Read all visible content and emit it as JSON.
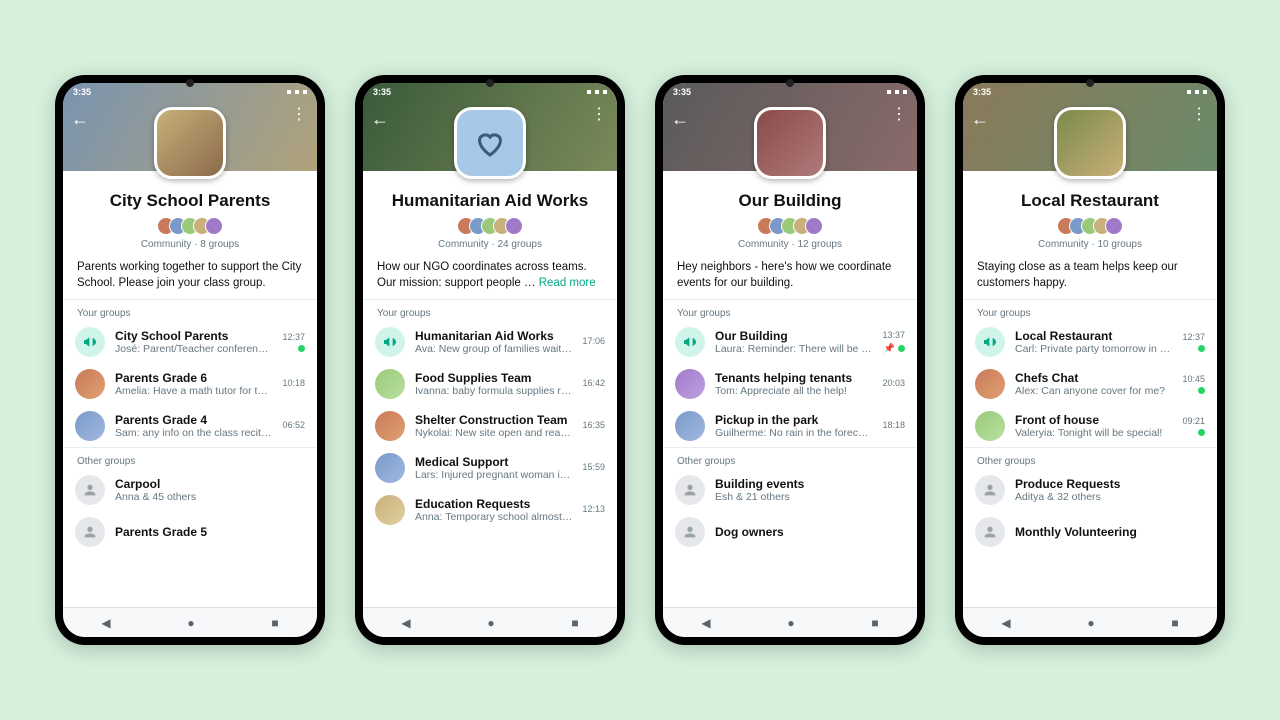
{
  "status_time": "3:35",
  "phones": [
    {
      "title": "City School Parents",
      "meta": "Community · 8 groups",
      "desc": "Parents working together to support the City School. Please join your class group.",
      "read_more": false,
      "your_label": "Your groups",
      "other_label": "Other groups",
      "your_groups": [
        {
          "name": "City School Parents",
          "sender": "José",
          "msg": "Parent/Teacher conferences …",
          "time": "12:37",
          "unread": true,
          "announce": true
        },
        {
          "name": "Parents Grade 6",
          "sender": "Amelia",
          "msg": "Have a math tutor for the upco…",
          "time": "10:18",
          "av": "ra0"
        },
        {
          "name": "Parents Grade 4",
          "sender": "Sam",
          "msg": "any info on the class recital?",
          "time": "06:52",
          "av": "ra1"
        }
      ],
      "other_groups": [
        {
          "name": "Carpool",
          "sub": "Anna & 45 others",
          "grey": true
        },
        {
          "name": "Parents Grade 5",
          "sub": "",
          "grey": true
        }
      ]
    },
    {
      "title": "Humanitarian Aid Works",
      "meta": "Community · 24 groups",
      "desc": "How our NGO coordinates across teams. Our mission: support people … ",
      "read_more": true,
      "read_more_label": "Read more",
      "your_label": "Your groups",
      "your_groups": [
        {
          "name": "Humanitarian Aid Works",
          "sender": "Ava",
          "msg": "New group of families waiting …",
          "time": "17:06",
          "announce": true
        },
        {
          "name": "Food Supplies Team",
          "sender": "Ivanna",
          "msg": "baby formula supplies running …",
          "time": "16:42",
          "av": "ra2"
        },
        {
          "name": "Shelter Construction Team",
          "sender": "Nykolai",
          "msg": "New site open and ready for …",
          "time": "16:35",
          "av": "ra0"
        },
        {
          "name": "Medical Support",
          "sender": "Lars",
          "msg": "Injured pregnant woman in need …",
          "time": "15:59",
          "av": "ra1"
        },
        {
          "name": "Education Requests",
          "sender": "Anna",
          "msg": "Temporary school almost comp…",
          "time": "12:13",
          "av": "ra3"
        }
      ],
      "other_groups": []
    },
    {
      "title": "Our Building",
      "meta": "Community · 12 groups",
      "desc": "Hey neighbors - here's how we coordinate events for our building.",
      "read_more": false,
      "your_label": "Your groups",
      "other_label": "Other groups",
      "your_groups": [
        {
          "name": "Our Building",
          "sender": "Laura",
          "msg": "Reminder:  There will be …",
          "time": "13:37",
          "unread": true,
          "pinned": true,
          "announce": true
        },
        {
          "name": "Tenants helping tenants",
          "sender": "Tom",
          "msg": "Appreciate all the help!",
          "time": "20:03",
          "av": "ra4"
        },
        {
          "name": "Pickup in the park",
          "sender": "Guilherme",
          "msg": "No rain in the forecast!",
          "time": "18:18",
          "av": "ra1"
        }
      ],
      "other_groups": [
        {
          "name": "Building events",
          "sub": "Esh & 21 others",
          "grey": true
        },
        {
          "name": "Dog owners",
          "sub": "",
          "grey": true
        }
      ]
    },
    {
      "title": "Local Restaurant",
      "meta": "Community · 10 groups",
      "desc": "Staying close as a team helps keep our customers happy.",
      "read_more": false,
      "your_label": "Your groups",
      "other_label": "Other groups",
      "your_groups": [
        {
          "name": "Local Restaurant",
          "sender": "Carl",
          "msg": "Private party tomorrow in the …",
          "time": "12:37",
          "unread": true,
          "announce": true
        },
        {
          "name": "Chefs Chat",
          "sender": "Alex",
          "msg": "Can anyone cover for me?",
          "time": "10:45",
          "unread": true,
          "av": "ra0"
        },
        {
          "name": "Front of house",
          "sender": "Valeryia",
          "msg": "Tonight will be special!",
          "time": "09:21",
          "unread": true,
          "av": "ra2"
        }
      ],
      "other_groups": [
        {
          "name": "Produce Requests",
          "sub": "Aditya & 32 others",
          "grey": true
        },
        {
          "name": "Monthly Volunteering",
          "sub": "",
          "grey": true
        }
      ]
    }
  ]
}
